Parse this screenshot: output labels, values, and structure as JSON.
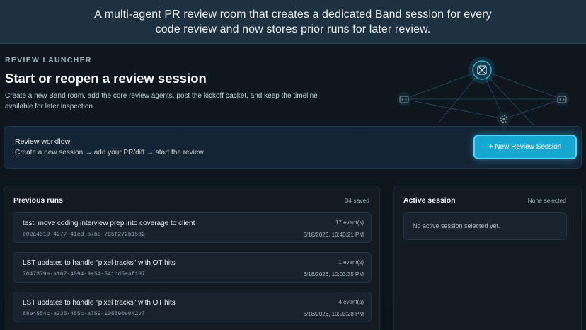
{
  "banner": {
    "text": "A multi-agent PR review room that creates a dedicated Band session for every code review and now stores prior runs for later review."
  },
  "launcher": {
    "eyebrow": "REVIEW LAUNCHER",
    "title": "Start or reopen a review session",
    "description": "Create a new Band room, add the core review agents, post the kickoff packet, and keep the timeline available for later inspection.",
    "network_icons": [
      "agent-hub-icon",
      "robot-icon",
      "robot-icon",
      "gear-icon"
    ]
  },
  "workflow": {
    "title": "Review workflow",
    "steps": "Create a new session → add your PR/diff → start the review",
    "button_label": "+ New Review Session"
  },
  "previous_runs": {
    "title": "Previous runs",
    "count": "34 saved",
    "items": [
      {
        "title": "test, move coding interview prep into coverage to client",
        "id": "e02a4010-4277-41ed b7be-7S5f272b15d2",
        "events": "17 event(s)",
        "time": "6/18/2026, 10:43:21 PM"
      },
      {
        "title": "LST updates to handle \"pixel tracks\" with OT hits",
        "id": "7047379e-a167-4094-9e54-541bd5eaf187",
        "events": "1 event(s)",
        "time": "6/18/2026, 10:03:35 PM"
      },
      {
        "title": "LST updates to handle \"pixel tracks\" with OT hits",
        "id": "88e4554c-a335-485c-a759-105890e042v7",
        "events": "4 event(s)",
        "time": "6/18/2026, 10:03:28 PM"
      }
    ]
  },
  "active_session": {
    "title": "Active session",
    "status": "None selected",
    "empty_message": "No active session selected yet."
  },
  "colors": {
    "accent": "#16a7d0",
    "background": "#0b1219",
    "banner": "#1d3140"
  }
}
